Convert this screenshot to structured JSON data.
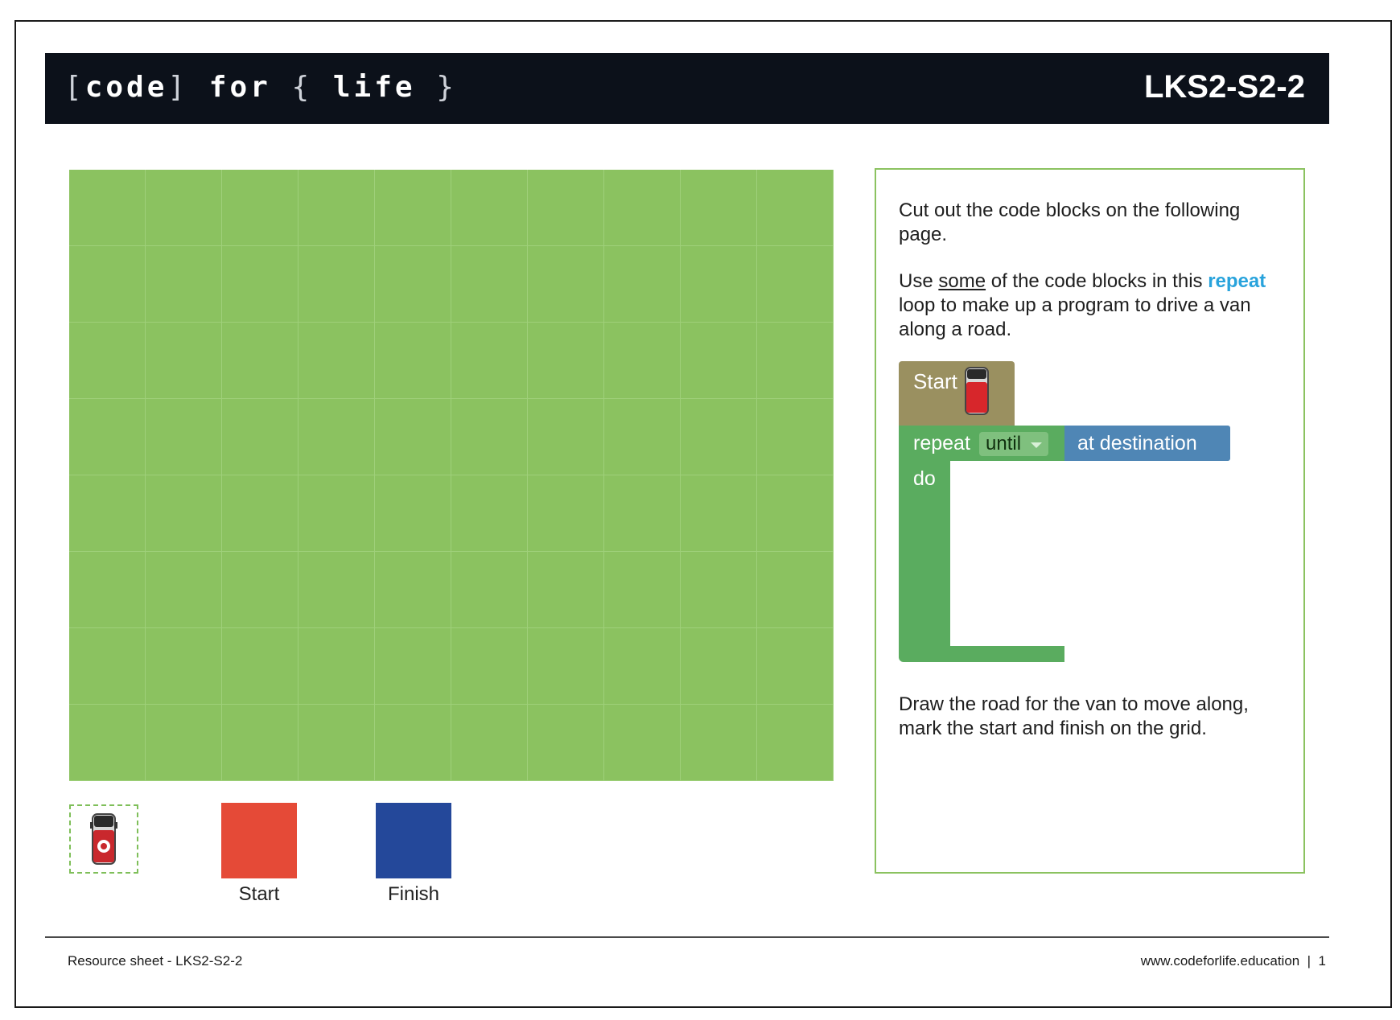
{
  "header": {
    "logo_parts": [
      "[",
      "code",
      "]",
      "for",
      "{",
      "life",
      "}"
    ],
    "code": "LKS2-S2-2"
  },
  "grid": {
    "columns": 10,
    "rows": 8,
    "color": "#8bc260"
  },
  "tokens": {
    "start_label": "Start",
    "finish_label": "Finish",
    "start_color": "#e54a37",
    "finish_color": "#24489a"
  },
  "panel": {
    "p1": "Cut out the code blocks on the following page.",
    "p2_a": "Use ",
    "p2_underlined": "some",
    "p2_b": " of the code blocks in this ",
    "p2_keyword": "repeat",
    "p2_c": " loop to make up a program to drive a van along a road.",
    "p3": "Draw the road for the van to move along, mark the start and finish on the grid."
  },
  "blocks": {
    "start_label": "Start",
    "repeat_label": "repeat",
    "until_option": "until",
    "condition_label": "at destination",
    "do_label": "do"
  },
  "footer": {
    "left": "Resource sheet - LKS2-S2-2",
    "right": "www.codeforlife.education  |  1"
  }
}
